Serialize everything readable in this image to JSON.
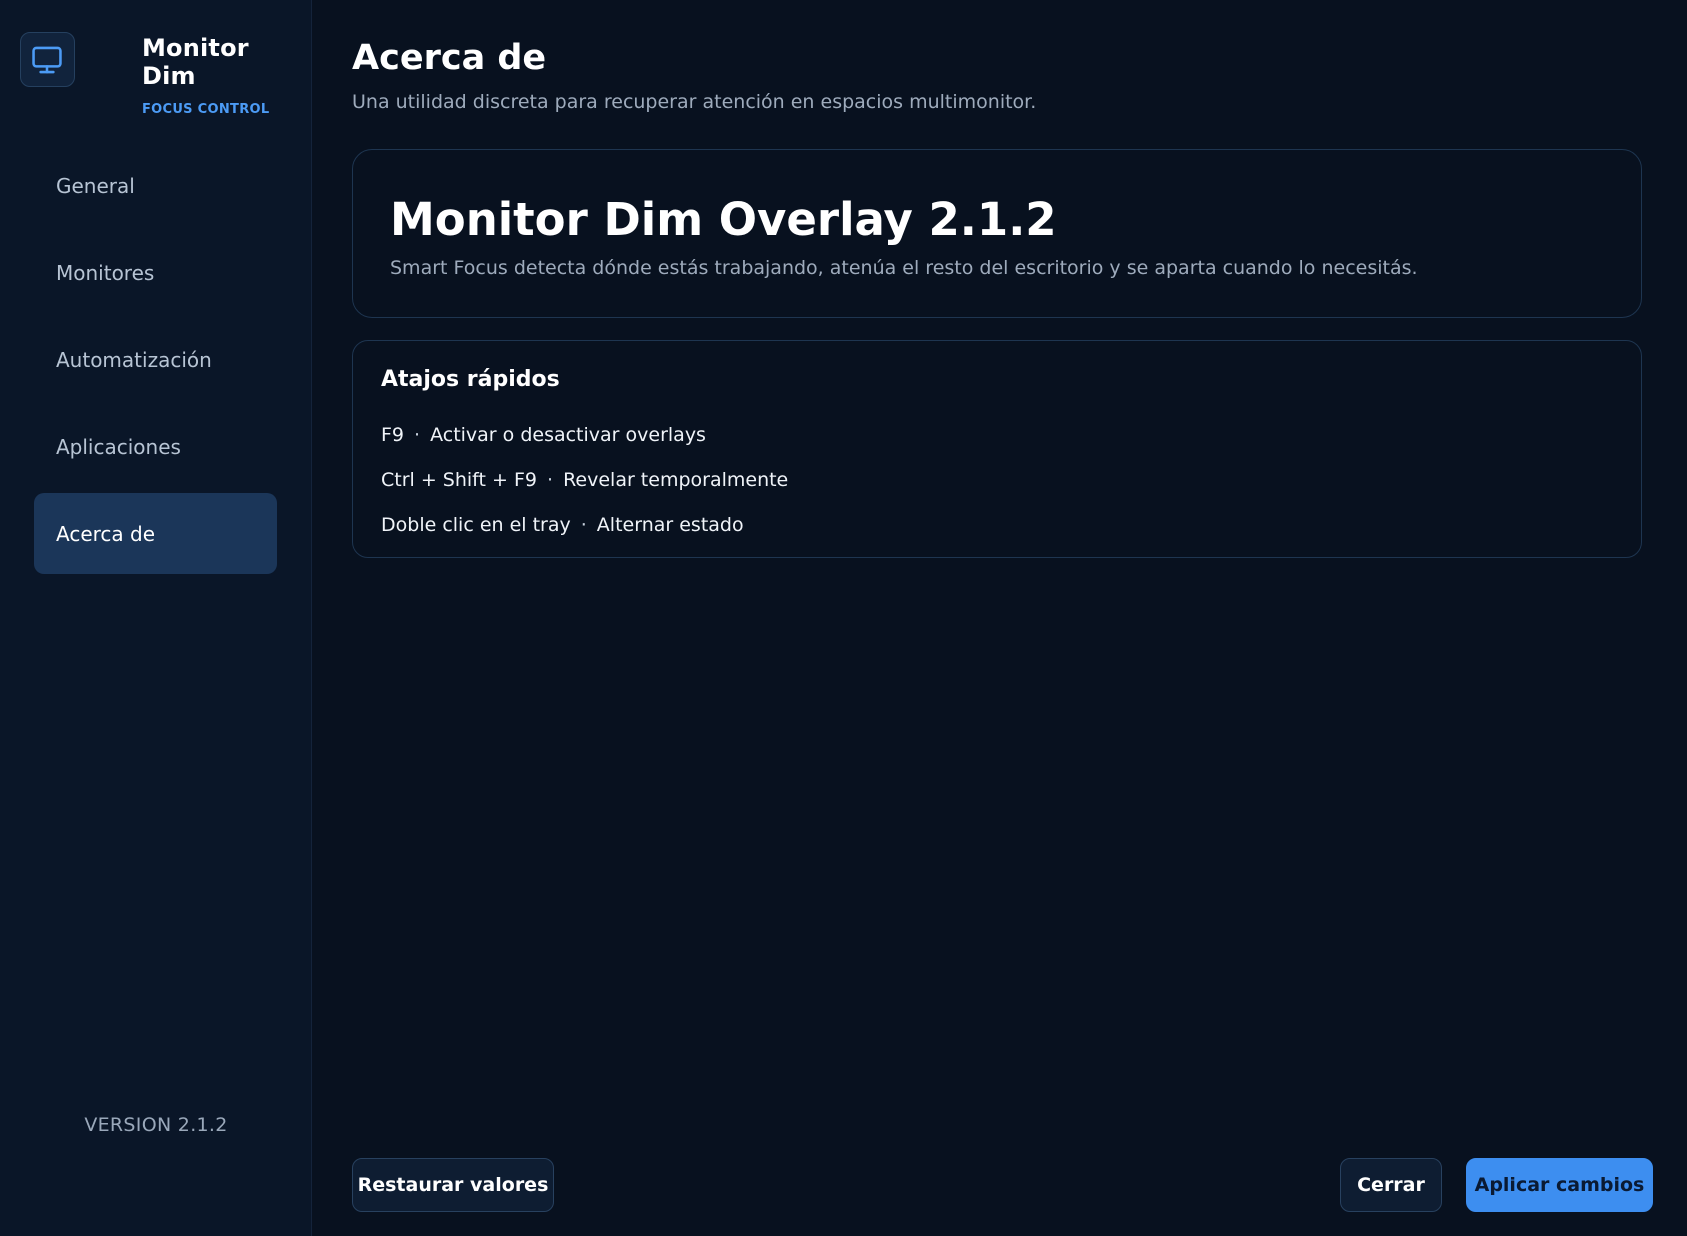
{
  "app": {
    "title": "Monitor Dim",
    "subtitle": "FOCUS CONTROL",
    "icon": "monitor-icon",
    "accent": "#4c9bf5"
  },
  "sidebar": {
    "items": [
      {
        "label": "General",
        "active": false
      },
      {
        "label": "Monitores",
        "active": false
      },
      {
        "label": "Automatización",
        "active": false
      },
      {
        "label": "Aplicaciones",
        "active": false
      },
      {
        "label": "Acerca de",
        "active": true
      }
    ],
    "version": "VERSION 2.1.2"
  },
  "page": {
    "title": "Acerca de",
    "subtitle": "Una utilidad discreta para recuperar atención en espacios multimonitor."
  },
  "hero": {
    "title": "Monitor Dim Overlay 2.1.2",
    "description": "Smart Focus detecta dónde estás trabajando, atenúa el resto del escritorio y se aparta cuando lo necesitás."
  },
  "shortcuts": {
    "title": "Atajos rápidos",
    "separator": "·",
    "items": [
      {
        "key": "F9",
        "action": "Activar o desactivar overlays"
      },
      {
        "key": "Ctrl + Shift + F9",
        "action": "Revelar temporalmente"
      },
      {
        "key": "Doble clic en el tray",
        "action": "Alternar estado"
      }
    ]
  },
  "footer": {
    "restore_label": "Restaurar valores",
    "close_label": "Cerrar",
    "apply_label": "Aplicar cambios"
  }
}
